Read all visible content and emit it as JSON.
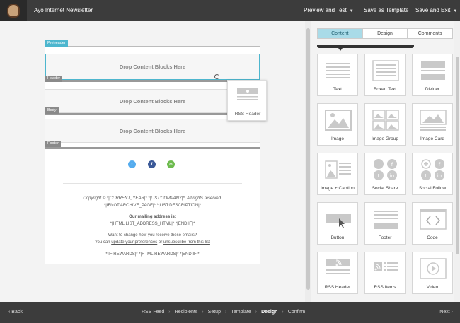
{
  "header": {
    "title": "Ayo Internet Newsletter",
    "preview_label": "Preview and Test",
    "save_template_label": "Save as Template",
    "save_exit_label": "Save and Exit"
  },
  "template": {
    "preheader_label": "Preheader",
    "header_label": "Header",
    "body_label": "Body",
    "footer_label": "Footer",
    "drop_text": "Drop Content Blocks Here",
    "footer_lines": {
      "copyright": "Copyright © *|CURRENT_YEAR|* *|LIST:COMPANY|*, All rights reserved.",
      "archive": "*|IFNOT:ARCHIVE_PAGE|* *|LIST:DESCRIPTION|*",
      "mailing_title": "Our mailing address is:",
      "mailing_value": "*|HTML:LIST_ADDRESS_HTML|* *|END:IF|*",
      "change_q": "Want to change how you receive these emails?",
      "change_prefix": "You can ",
      "update_link": "update your preferences",
      "change_mid": " or ",
      "unsubscribe_link": "unsubscribe from this list",
      "rewards": "*|IF:REWARDS|* *|HTML:REWARDS|* *|END:IF|*"
    }
  },
  "drag_card": {
    "label": "RSS Header"
  },
  "panel": {
    "tabs": [
      "Content",
      "Design",
      "Comments"
    ],
    "active_tab": "Content",
    "blocks": [
      {
        "label": "Text",
        "icon": "text-block-icon"
      },
      {
        "label": "Boxed Text",
        "icon": "boxed-text-icon"
      },
      {
        "label": "Divider",
        "icon": "divider-icon"
      },
      {
        "label": "Image",
        "icon": "image-icon"
      },
      {
        "label": "Image Group",
        "icon": "image-group-icon"
      },
      {
        "label": "Image Card",
        "icon": "image-card-icon"
      },
      {
        "label": "Image + Caption",
        "icon": "image-caption-icon"
      },
      {
        "label": "Social Share",
        "icon": "social-share-icon"
      },
      {
        "label": "Social Follow",
        "icon": "social-follow-icon"
      },
      {
        "label": "Button",
        "icon": "button-icon"
      },
      {
        "label": "Footer",
        "icon": "footer-icon"
      },
      {
        "label": "Code",
        "icon": "code-icon"
      },
      {
        "label": "RSS Header",
        "icon": "rss-header-icon"
      },
      {
        "label": "RSS Items",
        "icon": "rss-items-icon"
      },
      {
        "label": "Video",
        "icon": "video-icon"
      }
    ]
  },
  "footer_nav": {
    "back_label": "Back",
    "next_label": "Next",
    "steps": [
      "RSS Feed",
      "Recipients",
      "Setup",
      "Template",
      "Design",
      "Confirm"
    ],
    "current_step": "Design"
  },
  "colors": {
    "accent": "#4db6ce",
    "bar": "#3c3c3c",
    "twitter": "#55acee",
    "facebook": "#3b5998",
    "link": "#6dbb4e"
  }
}
